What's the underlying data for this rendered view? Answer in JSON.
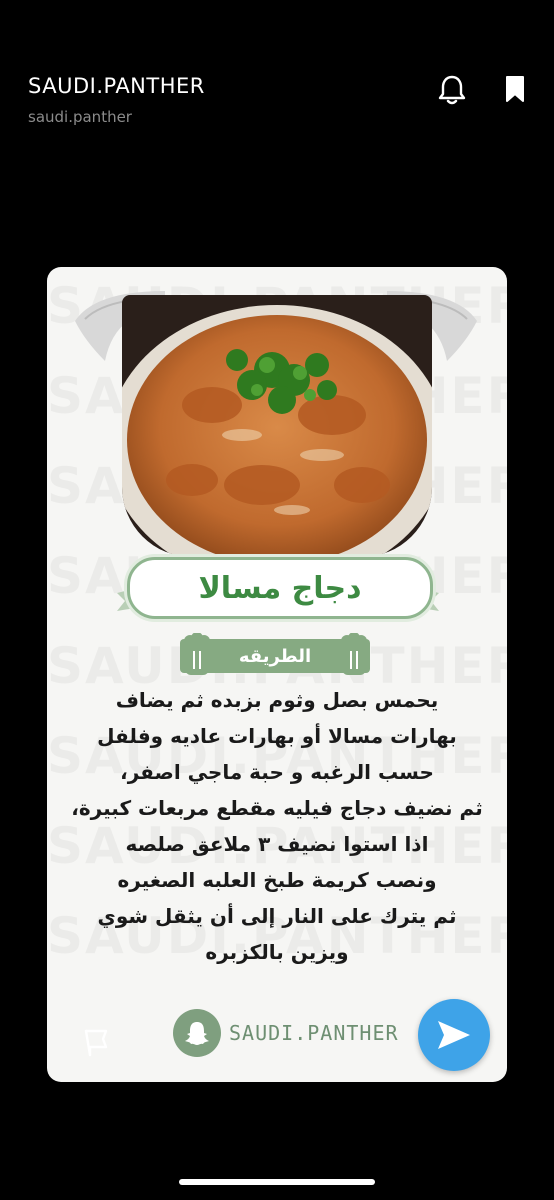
{
  "header": {
    "account_name": "SAUDI.PANTHER",
    "account_handle": "saudi.panther",
    "bell_icon": "bell-icon",
    "bookmark_icon": "bookmark-icon"
  },
  "card": {
    "watermark": "SAUDI.PANTHER",
    "dish_title": "دجاج مسالا",
    "method_label": "الطريقه",
    "recipe_lines": [
      "يحمس بصل وثوم بزبده ثم يضاف",
      "بهارات مسالا أو بهارات عاديه وفلفل",
      "حسب الرغبه و حبة ماجي اصفر،",
      "ثم نضيف دجاج فيليه مقطع مربعات كبيرة،",
      "اذا استوا نضيف ٣ ملاعق صلصه",
      "ونصب كريمة طبخ العلبه الصغيره",
      "ثم يترك على النار إلى أن يثقل شوي",
      "ويزين بالكزبره"
    ],
    "brand_text": "SAUDI.PANTHER",
    "report_icon": "flag-icon",
    "send_icon": "send-arrow-icon"
  },
  "colors": {
    "background": "#000000",
    "card": "#f6f6f4",
    "title_green": "#3d8a42",
    "method_bar": "#86aa82",
    "send_blue": "#3ea3e8"
  }
}
